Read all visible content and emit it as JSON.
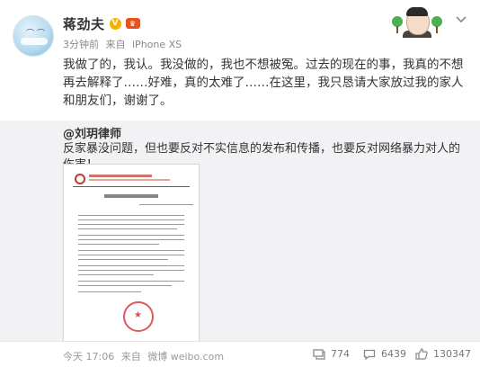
{
  "post": {
    "author": "蒋劲夫",
    "verified_badge": "V",
    "time": "3分钟前",
    "source_prefix": "来自",
    "source": "iPhone XS",
    "content": "我做了的，我认。我没做的，我也不想被冤。过去的现在的事，我真的不想再去解释了……好难，真的太难了……在这里，我只恳请大家放过我的家人和朋友们，谢谢了。",
    "more_icon": "chevron-down-icon"
  },
  "repost": {
    "author": "@刘玥律师",
    "text": "反家暴没问题，但也要反对不实信息的发布和传播，也要反对网络暴力对人的伤害！"
  },
  "footer": {
    "time": "今天 17:06",
    "source_prefix": "来自",
    "source": "微博 weibo.com",
    "repost_count": "774",
    "comment_count": "6439",
    "like_count": "130347"
  },
  "colors": {
    "accent_orange": "#f7b000",
    "repost_bg": "#f2f2f5",
    "stamp_red": "#d32f2f"
  }
}
